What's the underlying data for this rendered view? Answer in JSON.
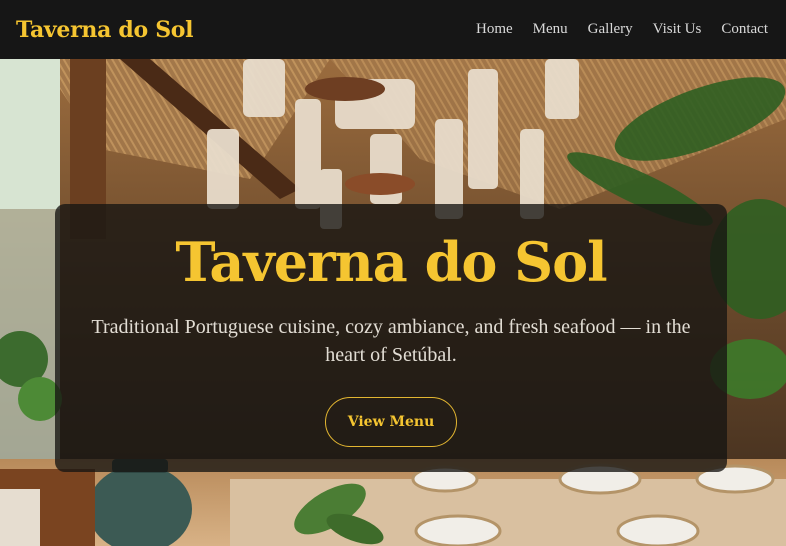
{
  "nav": {
    "brand": "Taverna do Sol",
    "links": [
      "Home",
      "Menu",
      "Gallery",
      "Visit Us",
      "Contact"
    ]
  },
  "hero": {
    "title": "Taverna do Sol",
    "subtitle": "Traditional Portuguese cuisine, cozy ambiance, and fresh seafood — in the heart of Setúbal.",
    "cta_label": "View Menu"
  },
  "colors": {
    "accent": "#f5c531",
    "nav_background": "#161616",
    "card_background": "#161412"
  }
}
